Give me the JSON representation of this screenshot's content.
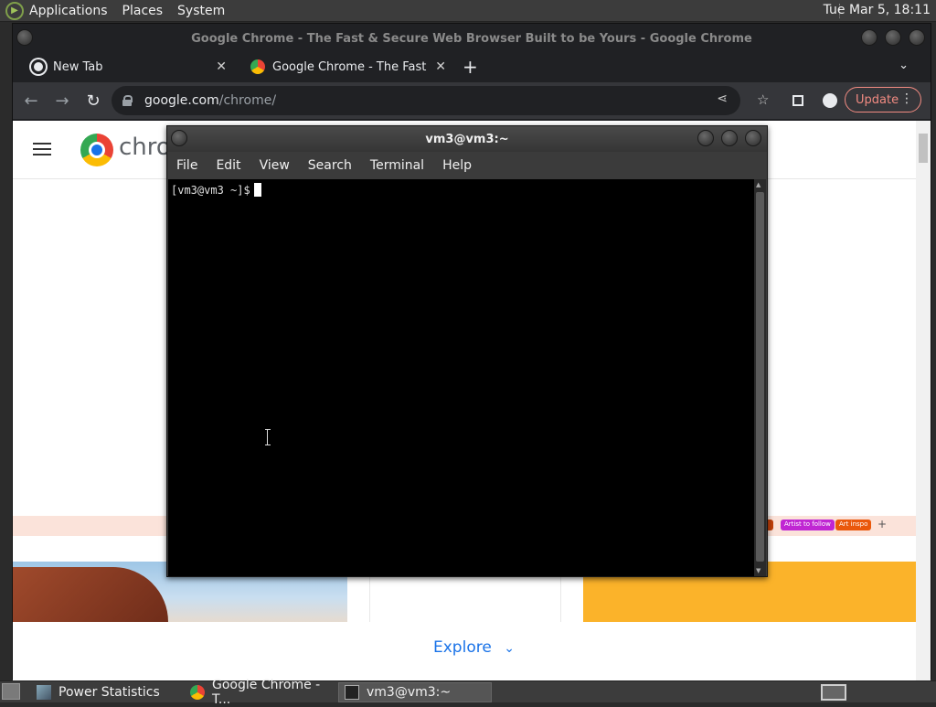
{
  "top_panel": {
    "menus": [
      "Applications",
      "Places",
      "System"
    ],
    "clock": "Tue Mar  5, 18:11"
  },
  "chrome": {
    "window_title": "Google Chrome - The Fast & Secure Web Browser Built to be Yours - Google Chrome",
    "tabs": [
      {
        "label": "New Tab"
      },
      {
        "label": "Google Chrome - The Fast & Secure"
      }
    ],
    "url_host": "google.com",
    "url_path": "/chrome/",
    "update_label": "Update",
    "page": {
      "brand_text": "chro",
      "chips": [
        "Artist to follow",
        "Art inspo"
      ],
      "chip_plus": "+",
      "explore": "Explore"
    }
  },
  "terminal": {
    "title": "vm3@vm3:~",
    "menus": [
      "File",
      "Edit",
      "View",
      "Search",
      "Terminal",
      "Help"
    ],
    "prompt": "[vm3@vm3 ~]$"
  },
  "taskbar": {
    "items": [
      {
        "label": "Power Statistics"
      },
      {
        "label": "Google Chrome - T..."
      },
      {
        "label": "vm3@vm3:~"
      }
    ]
  },
  "colors": {
    "panel": "#3c3c3c",
    "chrome_dark": "#202124",
    "update_accent": "#f28b82",
    "link_blue": "#1a73e8",
    "terminal_bg": "#000000"
  }
}
